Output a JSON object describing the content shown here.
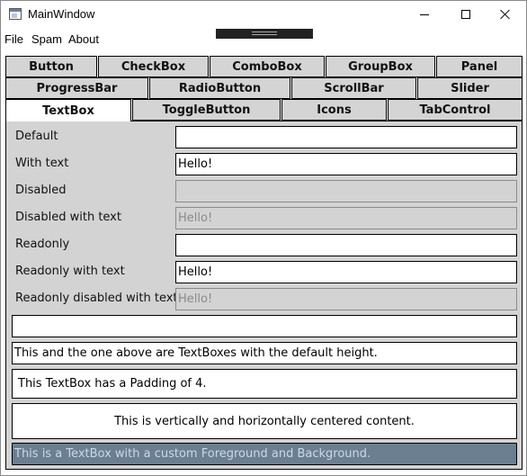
{
  "window": {
    "title": "MainWindow"
  },
  "menu": {
    "items": [
      "File",
      "Spam",
      "About"
    ]
  },
  "tabs": {
    "row1": [
      "Button",
      "CheckBox",
      "ComboBox",
      "GroupBox",
      "Panel"
    ],
    "row2": [
      "ProgressBar",
      "RadioButton",
      "ScrollBar",
      "Slider"
    ],
    "row3": [
      "TextBox",
      "ToggleButton",
      "Icons",
      "TabControl"
    ],
    "selected": "TextBox"
  },
  "textbox_rows": [
    {
      "label": "Default",
      "value": "",
      "state": "normal"
    },
    {
      "label": "With text",
      "value": "Hello!",
      "state": "normal"
    },
    {
      "label": "Disabled",
      "value": "",
      "state": "disabled"
    },
    {
      "label": "Disabled with text",
      "value": "Hello!",
      "state": "disabled"
    },
    {
      "label": "Readonly",
      "value": "",
      "state": "readonly"
    },
    {
      "label": "Readonly with text",
      "value": "Hello!",
      "state": "readonly"
    },
    {
      "label": "Readonly disabled with text",
      "value": "Hello!",
      "state": "readonly-disabled"
    }
  ],
  "wide_boxes": [
    {
      "text": "",
      "style": "default-height"
    },
    {
      "text": "This and the one above are TextBoxes with the default height.",
      "style": "default-height"
    },
    {
      "text": "This TextBox has a Padding of 4.",
      "style": "padding-4"
    },
    {
      "text": "This is vertically and horizontally centered content.",
      "style": "centered"
    },
    {
      "text": "This is a TextBox with a custom Foreground and Background.",
      "style": "custom-colors"
    }
  ],
  "colors": {
    "panel_bg": "#d3d3d3",
    "custom_bg": "#6b7f91",
    "custom_fg": "#c9d8ea",
    "disabled_text": "#8a8a8a"
  }
}
